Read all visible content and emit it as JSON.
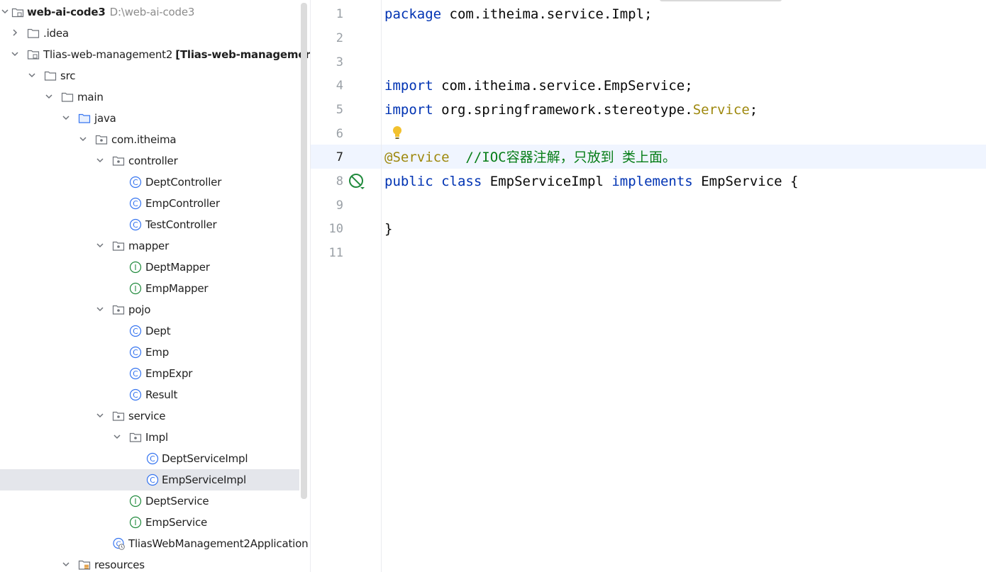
{
  "tree": {
    "root": {
      "label": "web-ai-code3",
      "path": "D:\\web-ai-code3"
    },
    "items": [
      {
        "label": ".idea",
        "kind": "folder"
      },
      {
        "label": "Tlias-web-management2",
        "module": "[Tlias-web-management]",
        "kind": "module"
      },
      {
        "label": "src",
        "kind": "folder"
      },
      {
        "label": "main",
        "kind": "folder"
      },
      {
        "label": "java",
        "kind": "source-folder"
      },
      {
        "label": "com.itheima",
        "kind": "package"
      },
      {
        "label": "controller",
        "kind": "package"
      },
      {
        "label": "DeptController",
        "kind": "class"
      },
      {
        "label": "EmpController",
        "kind": "class"
      },
      {
        "label": "TestController",
        "kind": "class"
      },
      {
        "label": "mapper",
        "kind": "package"
      },
      {
        "label": "DeptMapper",
        "kind": "interface"
      },
      {
        "label": "EmpMapper",
        "kind": "interface"
      },
      {
        "label": "pojo",
        "kind": "package"
      },
      {
        "label": "Dept",
        "kind": "class"
      },
      {
        "label": "Emp",
        "kind": "class"
      },
      {
        "label": "EmpExpr",
        "kind": "class"
      },
      {
        "label": "Result",
        "kind": "class"
      },
      {
        "label": "service",
        "kind": "package"
      },
      {
        "label": "Impl",
        "kind": "package"
      },
      {
        "label": "DeptServiceImpl",
        "kind": "class"
      },
      {
        "label": "EmpServiceImpl",
        "kind": "class",
        "selected": true
      },
      {
        "label": "DeptService",
        "kind": "interface"
      },
      {
        "label": "EmpService",
        "kind": "interface"
      },
      {
        "label": "TliasWebManagement2Application",
        "kind": "spring-app"
      },
      {
        "label": "resources",
        "kind": "resources-folder"
      }
    ]
  },
  "editor": {
    "line_numbers": [
      "1",
      "2",
      "3",
      "4",
      "5",
      "6",
      "7",
      "8",
      "9",
      "10",
      "11"
    ],
    "current_line": "7",
    "lines": {
      "l1_kw": "package",
      "l1_rest": " com.itheima.service.Impl;",
      "l4_kw": "import",
      "l4_rest": " com.itheima.service.EmpService;",
      "l5_kw": "import",
      "l5_rest": " org.springframework.stereotype.",
      "l5_ann": "Service",
      "l5_end": ";",
      "l7_ann": "@Service",
      "l7_cmt": "  //IOC容器注解，只放到 类上面。",
      "l8_kw1": "public",
      "l8_kw2": "class",
      "l8_name": "EmpServiceImpl",
      "l8_kw3": "implements",
      "l8_iface": "EmpService",
      "l8_brace": "{",
      "l10_brace": "}"
    }
  },
  "colors": {
    "keyword": "#0033b3",
    "annotation": "#9e880d",
    "comment": "#067d17",
    "selection": "#e4e6eb",
    "current_line": "#f0f5ff"
  }
}
